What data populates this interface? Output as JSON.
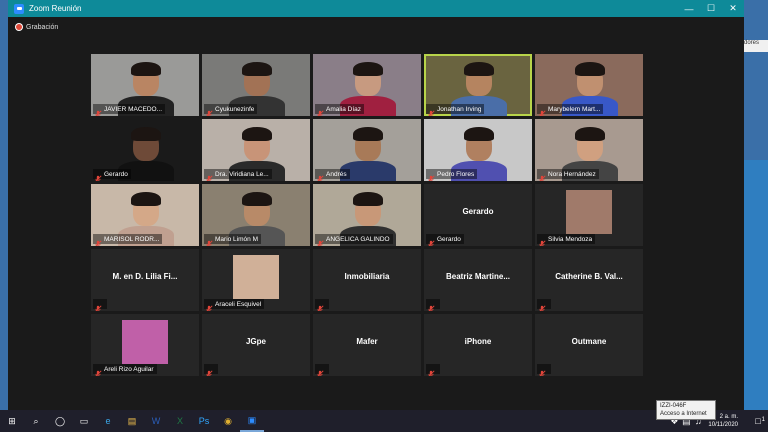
{
  "window": {
    "title": "Zoom Reunión",
    "recording_label": "Grabación"
  },
  "background_peek": "dores",
  "participants": [
    {
      "name": "JAVIER MACEDO...",
      "type": "video",
      "bg": "#9a9a98",
      "skin": "#b98563",
      "shirt": "#222"
    },
    {
      "name": "Cyukunezinfe",
      "type": "video",
      "bg": "#7a7a78",
      "skin": "#a27255",
      "shirt": "#333"
    },
    {
      "name": "Amalia Díaz",
      "type": "video",
      "bg": "#8a7e88",
      "skin": "#c79a80",
      "shirt": "#a02040"
    },
    {
      "name": "Jonathan Irving",
      "type": "video",
      "bg": "#6a6440",
      "skin": "#b58460",
      "shirt": "#4a6ea8",
      "active": true
    },
    {
      "name": "Marybelem Mart...",
      "type": "video",
      "bg": "#8a6a5c",
      "skin": "#c09070",
      "shirt": "#3858c8"
    },
    {
      "name": "Gerardo",
      "type": "video",
      "bg": "#1a1a1a",
      "skin": "#6e4a38",
      "shirt": "#111"
    },
    {
      "name": "Dra. Viridiana Le...",
      "type": "video",
      "bg": "#b9b0a8",
      "skin": "#c89478",
      "shirt": "#2a2a2a"
    },
    {
      "name": "Andrés",
      "type": "video",
      "bg": "#a4a09a",
      "skin": "#a87a58",
      "shirt": "#2a3a6a"
    },
    {
      "name": "Pedro Flores",
      "type": "video",
      "bg": "#c8c8c8",
      "skin": "#b08060",
      "shirt": "#5050b0"
    },
    {
      "name": "Nora Hernández",
      "type": "video",
      "bg": "#a89a90",
      "skin": "#d0a080",
      "shirt": "#444"
    },
    {
      "name": "MARISOL RODR...",
      "type": "video",
      "bg": "#c8b8a8",
      "skin": "#d4a888",
      "shirt": "#c0a090"
    },
    {
      "name": "Mario Limón M",
      "type": "video",
      "bg": "#8a8070",
      "skin": "#b88a68",
      "shirt": "#555"
    },
    {
      "name": "ANGELICA GALINDO",
      "type": "video",
      "bg": "#b0a898",
      "skin": "#c89878",
      "shirt": "#303030"
    },
    {
      "name": "Gerardo",
      "type": "name",
      "center": "Gerardo"
    },
    {
      "name": "Silvia Mendoza",
      "type": "avatar",
      "avatar_color": "#a07a6a"
    },
    {
      "name": "",
      "type": "name",
      "center": "M. en D. Lilia Fi..."
    },
    {
      "name": "Araceli Esquivel",
      "type": "avatar",
      "avatar_color": "#d0b098"
    },
    {
      "name": "",
      "type": "name",
      "center": "Inmobiliaria"
    },
    {
      "name": "",
      "type": "name",
      "center": "Beatriz Martine..."
    },
    {
      "name": "",
      "type": "name",
      "center": "Catherine B. Val..."
    },
    {
      "name": "Areli Rizo Aguilar",
      "type": "avatar",
      "avatar_color": "#c060a8"
    },
    {
      "name": "",
      "type": "name",
      "center": "JGpe"
    },
    {
      "name": "",
      "type": "name",
      "center": "Mafer"
    },
    {
      "name": "",
      "type": "name",
      "center": "iPhone"
    },
    {
      "name": "",
      "type": "name",
      "center": "Outmane"
    }
  ],
  "taskbar": {
    "icons": [
      "windows-icon",
      "search-icon",
      "cortana-icon",
      "task-view-icon",
      "edge-icon",
      "file-explorer-icon",
      "word-icon",
      "excel-icon",
      "photoshop-icon",
      "chrome-icon",
      "zoom-icon"
    ],
    "clock_time": "2 a. m.",
    "clock_date": "10/11/2020",
    "notification_count": "1"
  },
  "tooltip": {
    "line1": "IZZI-046F",
    "line2": "Acceso a Internet"
  },
  "colors": {
    "titlebar": "#0e8a99",
    "active_border": "#b8d44a",
    "muted_mic": "#e0453a"
  }
}
